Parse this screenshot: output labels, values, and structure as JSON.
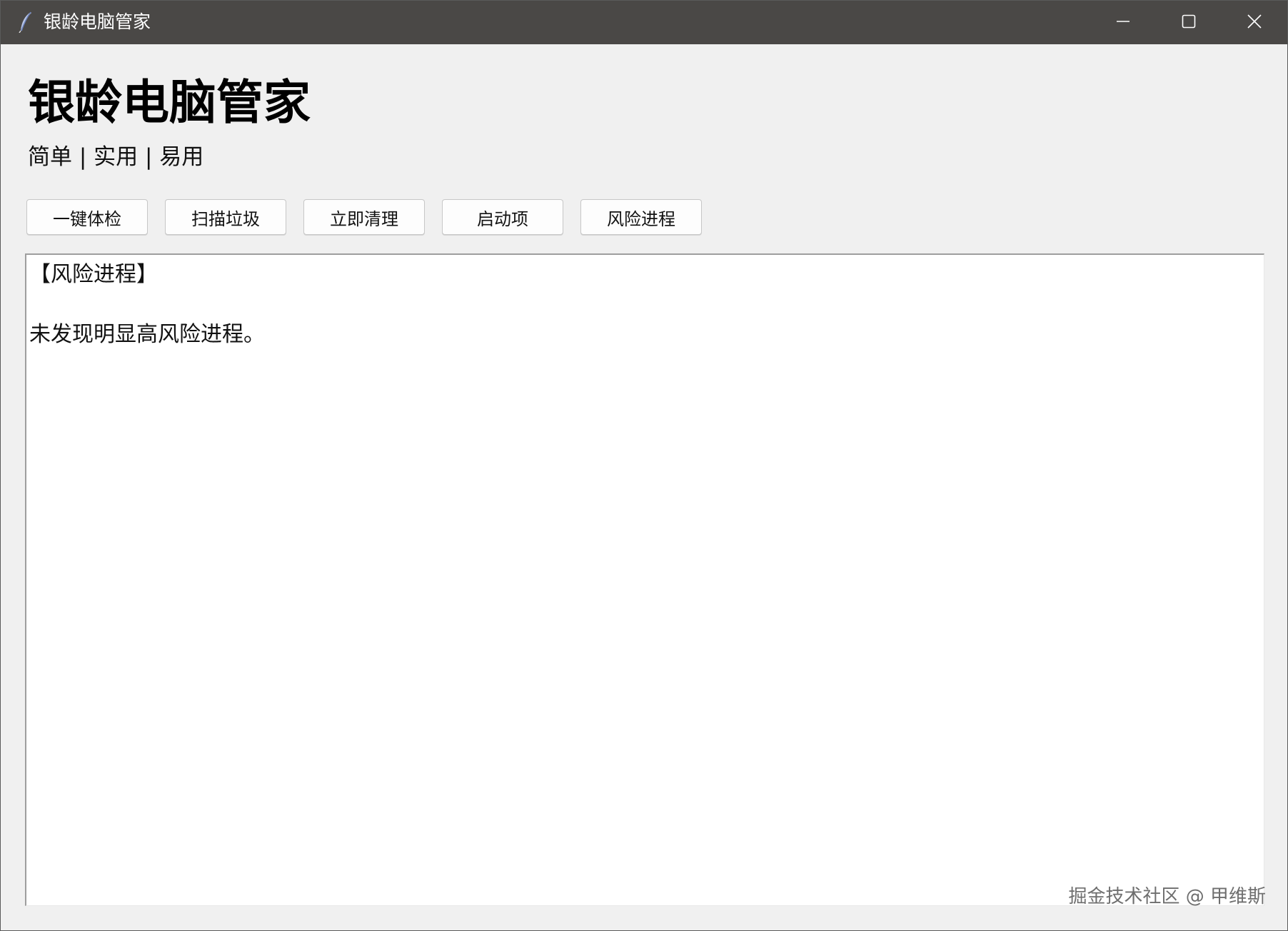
{
  "window": {
    "title": "银龄电脑管家",
    "icon": "feather-icon"
  },
  "header": {
    "title": "银龄电脑管家",
    "subtitle": "简单 | 实用 | 易用"
  },
  "toolbar": {
    "buttons": [
      {
        "label": "一键体检"
      },
      {
        "label": "扫描垃圾"
      },
      {
        "label": "立即清理"
      },
      {
        "label": "启动项"
      },
      {
        "label": "风险进程"
      }
    ]
  },
  "output": {
    "heading": "【风险进程】",
    "message": "未发现明显高风险进程。"
  },
  "watermark": "掘金技术社区 @ 甲维斯",
  "colors": {
    "titlebar": "#4a4846",
    "window_bg": "#f0f0f0",
    "output_bg": "#ffffff"
  }
}
